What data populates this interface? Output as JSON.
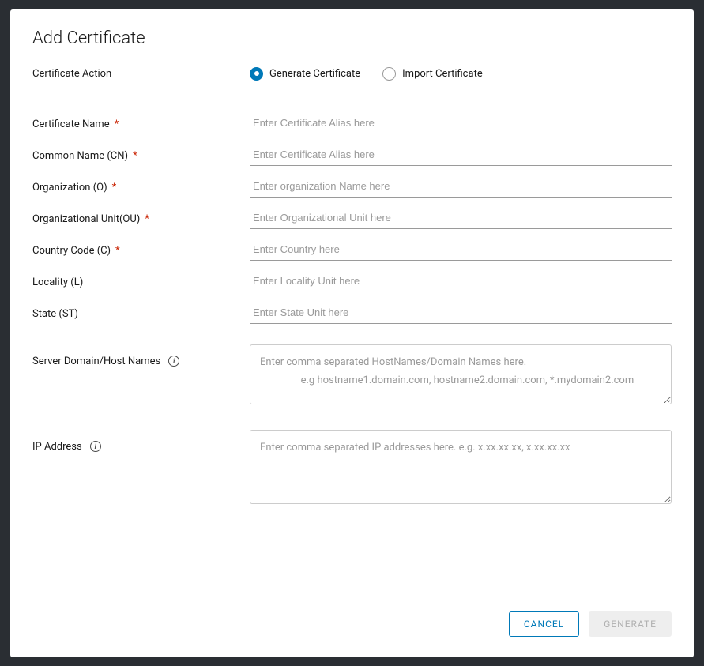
{
  "title": "Add Certificate",
  "action": {
    "label": "Certificate Action",
    "options": {
      "generate": "Generate Certificate",
      "import": "Import Certificate"
    },
    "selected": "generate"
  },
  "fields": {
    "certName": {
      "label": "Certificate Name",
      "required": true,
      "placeholder": "Enter Certificate Alias here"
    },
    "commonName": {
      "label": "Common Name (CN)",
      "required": true,
      "placeholder": "Enter Certificate Alias here"
    },
    "organization": {
      "label": "Organization (O)",
      "required": true,
      "placeholder": "Enter organization Name here"
    },
    "orgUnit": {
      "label": "Organizational Unit(OU)",
      "required": true,
      "placeholder": "Enter Organizational Unit here"
    },
    "countryCode": {
      "label": "Country Code (C)",
      "required": true,
      "placeholder": "Enter Country here"
    },
    "locality": {
      "label": "Locality (L)",
      "required": false,
      "placeholder": "Enter Locality Unit here"
    },
    "state": {
      "label": "State (ST)",
      "required": false,
      "placeholder": "Enter State Unit here"
    },
    "hostNames": {
      "label": "Server Domain/Host Names",
      "info": true,
      "placeholder": "Enter comma separated HostNames/Domain Names here.\n                e.g hostname1.domain.com, hostname2.domain.com, *.mydomain2.com"
    },
    "ipAddress": {
      "label": "IP Address",
      "info": true,
      "placeholder": "Enter comma separated IP addresses here. e.g. x.xx.xx.xx, x.xx.xx.xx"
    }
  },
  "buttons": {
    "cancel": "CANCEL",
    "generate": "GENERATE"
  }
}
